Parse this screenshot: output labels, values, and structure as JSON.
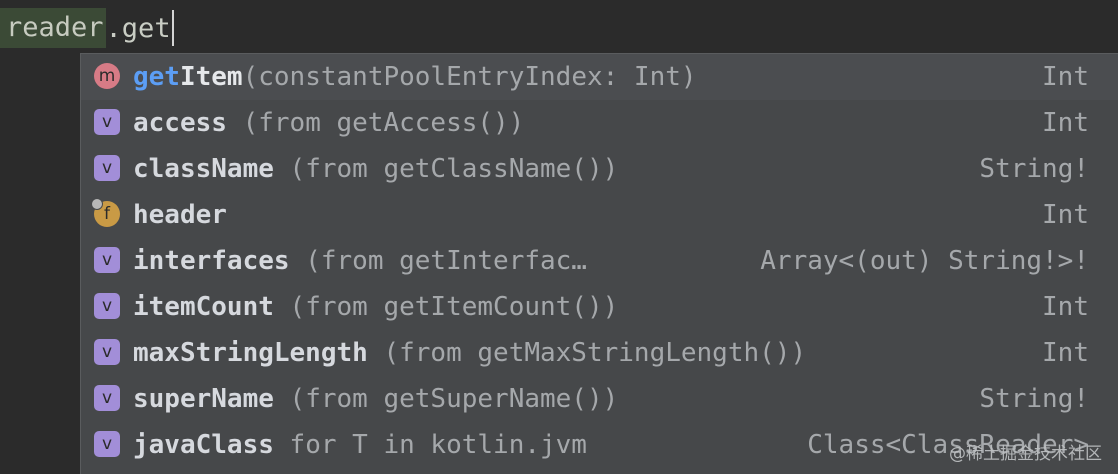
{
  "editor": {
    "receiver": "reader",
    "typed": ".get"
  },
  "completion": {
    "items": [
      {
        "kind": "m",
        "kind_icon": "method-icon",
        "match": "get",
        "name": "Item",
        "detail": "(constantPoolEntryIndex: Int)",
        "type": "Int"
      },
      {
        "kind": "v",
        "kind_icon": "property-icon",
        "match": "",
        "name": "access",
        "detail": " (from getAccess())",
        "type": "Int"
      },
      {
        "kind": "v",
        "kind_icon": "property-icon",
        "match": "",
        "name": "className",
        "detail": " (from getClassName())",
        "type": "String!"
      },
      {
        "kind": "f",
        "kind_icon": "field-icon",
        "match": "",
        "name": "header",
        "detail": "",
        "type": "Int"
      },
      {
        "kind": "v",
        "kind_icon": "property-icon",
        "match": "",
        "name": "interfaces",
        "detail": " (from getInterfac…",
        "type": "Array<(out) String!>!"
      },
      {
        "kind": "v",
        "kind_icon": "property-icon",
        "match": "",
        "name": "itemCount",
        "detail": " (from getItemCount())",
        "type": "Int"
      },
      {
        "kind": "v",
        "kind_icon": "property-icon",
        "match": "",
        "name": "maxStringLength",
        "detail": " (from getMaxStringLength())",
        "type": "Int"
      },
      {
        "kind": "v",
        "kind_icon": "property-icon",
        "match": "",
        "name": "superName",
        "detail": " (from getSuperName())",
        "type": "String!"
      },
      {
        "kind": "v",
        "kind_icon": "property-icon",
        "match": "",
        "name": "javaClass",
        "detail": " for T in kotlin.jvm",
        "type": "Class<ClassReader>"
      }
    ]
  },
  "watermark": "@稀土掘金技术社区"
}
